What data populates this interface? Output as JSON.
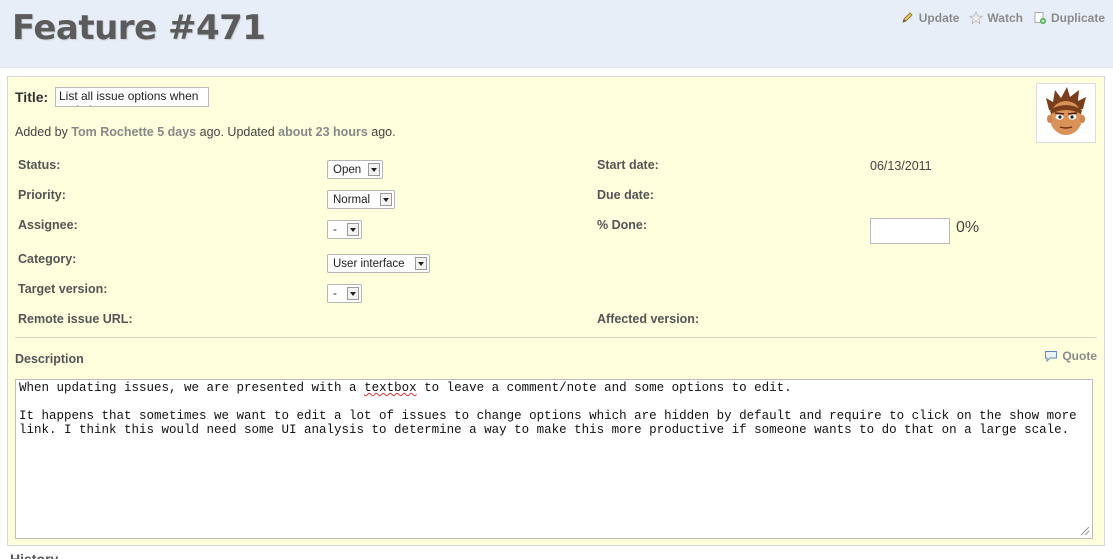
{
  "header": {
    "title": "Feature #471",
    "actions": {
      "update": "Update",
      "watch": "Watch",
      "duplicate": "Duplicate"
    }
  },
  "issue": {
    "title_label": "Title:",
    "title_value": "List all issue options when updating",
    "author": {
      "prefix": "Added by",
      "name": "Tom Rochette",
      "added_ago": "5 days",
      "middle": "ago. Updated",
      "updated_ago": "about 23 hours",
      "suffix": "ago."
    },
    "attributes": {
      "status": {
        "label": "Status:",
        "value": "Open"
      },
      "priority": {
        "label": "Priority:",
        "value": "Normal"
      },
      "assignee": {
        "label": "Assignee:",
        "value": "-"
      },
      "category": {
        "label": "Category:",
        "value": "User interface"
      },
      "target_version": {
        "label": "Target version:",
        "value": "-"
      },
      "remote_url": {
        "label": "Remote issue URL:"
      },
      "start_date": {
        "label": "Start date:",
        "value": "06/13/2011"
      },
      "due_date": {
        "label": "Due date:"
      },
      "done": {
        "label": "% Done:",
        "value": "0%"
      },
      "affected_version": {
        "label": "Affected version:"
      }
    },
    "description": {
      "label": "Description",
      "quote": "Quote",
      "line1_a": "When updating issues, we are presented with a ",
      "line1_spell": "textbox",
      "line1_b": " to leave a comment/note and some options to edit.",
      "paragraph2": "It happens that sometimes we want to edit a lot of issues to change options which are hidden by default and require to click on the show more link. I think this would need some UI analysis to determine a way to make this more productive if someone wants to do that on a large scale."
    }
  },
  "history": {
    "label": "History"
  }
}
